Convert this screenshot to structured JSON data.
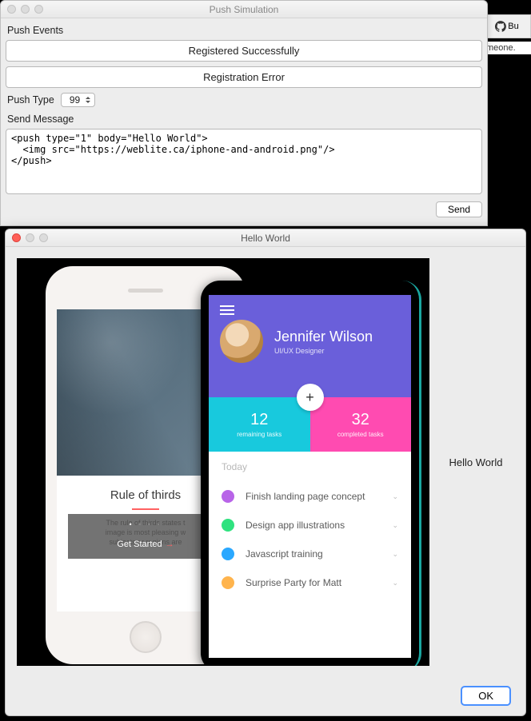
{
  "browser_tab": {
    "label": "Bu"
  },
  "browser_under": "meone.",
  "win1": {
    "title": "Push Simulation",
    "push_events_label": "Push Events",
    "btn_registered": "Registered Successfully",
    "btn_reg_error": "Registration Error",
    "push_type_label": "Push Type",
    "push_type_value": "99",
    "send_message_label": "Send Message",
    "message_body": "<push type=\"1\" body=\"Hello World\">\n  <img src=\"https://weblite.ca/iphone-and-android.png\"/>\n</push>",
    "send_btn": "Send"
  },
  "win2": {
    "title": "Hello World",
    "side_text": "Hello World",
    "ok_btn": "OK"
  },
  "iphone": {
    "title": "Rule of thirds",
    "body": "The rule of thirds states t\nimage is most pleasing w\nsubjects or regions are",
    "cta": "Get Started"
  },
  "android": {
    "name": "Jennifer Wilson",
    "role": "UI/UX Designer",
    "fab": "+",
    "stats": {
      "remaining_num": "12",
      "remaining_cap": "remaining tasks",
      "completed_num": "32",
      "completed_cap": "completed tasks"
    },
    "list_title": "Today",
    "items": [
      {
        "label": "Finish landing page concept"
      },
      {
        "label": "Design app illustrations"
      },
      {
        "label": "Javascript training"
      },
      {
        "label": "Surprise Party for Matt"
      }
    ]
  }
}
